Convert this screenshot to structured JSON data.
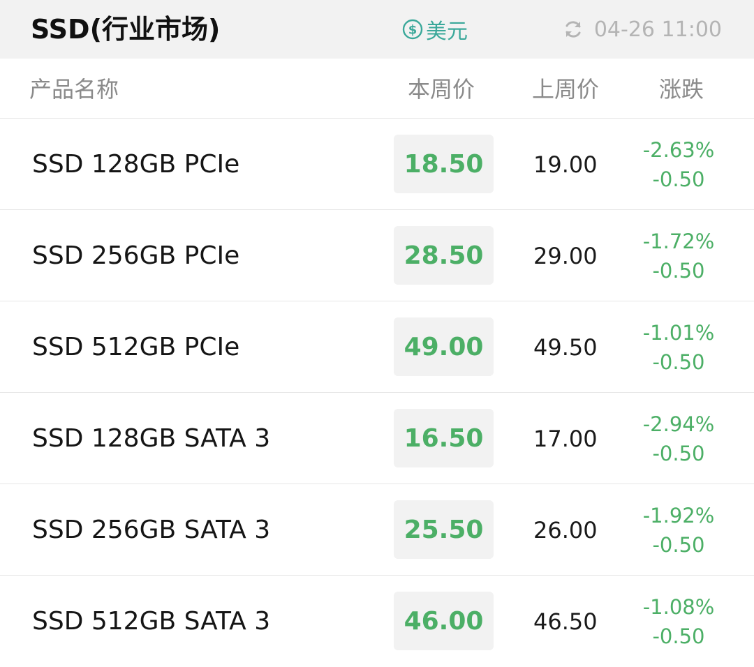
{
  "header": {
    "title": "SSD(行业市场)",
    "currency_label": "美元",
    "updated": "04-26 11:00"
  },
  "columns": {
    "name": "产品名称",
    "this_week": "本周价",
    "last_week": "上周价",
    "change": "涨跌"
  },
  "rows": [
    {
      "name": "SSD 128GB PCIe",
      "this_week": "18.50",
      "last_week": "19.00",
      "pct": "-2.63%",
      "diff": "-0.50"
    },
    {
      "name": "SSD 256GB PCIe",
      "this_week": "28.50",
      "last_week": "29.00",
      "pct": "-1.72%",
      "diff": "-0.50"
    },
    {
      "name": "SSD 512GB PCIe",
      "this_week": "49.00",
      "last_week": "49.50",
      "pct": "-1.01%",
      "diff": "-0.50"
    },
    {
      "name": "SSD 128GB SATA 3",
      "this_week": "16.50",
      "last_week": "17.00",
      "pct": "-2.94%",
      "diff": "-0.50"
    },
    {
      "name": "SSD 256GB SATA 3",
      "this_week": "25.50",
      "last_week": "26.00",
      "pct": "-1.92%",
      "diff": "-0.50"
    },
    {
      "name": "SSD 512GB SATA 3",
      "this_week": "46.00",
      "last_week": "46.50",
      "pct": "-1.08%",
      "diff": "-0.50"
    }
  ],
  "colors": {
    "down": "#4caf66",
    "accent": "#3aa89a",
    "muted": "#b4b4b4",
    "header_bg": "#f2f2f2"
  },
  "icons": {
    "currency": "dollar-circle-icon",
    "refresh": "refresh-icon"
  }
}
